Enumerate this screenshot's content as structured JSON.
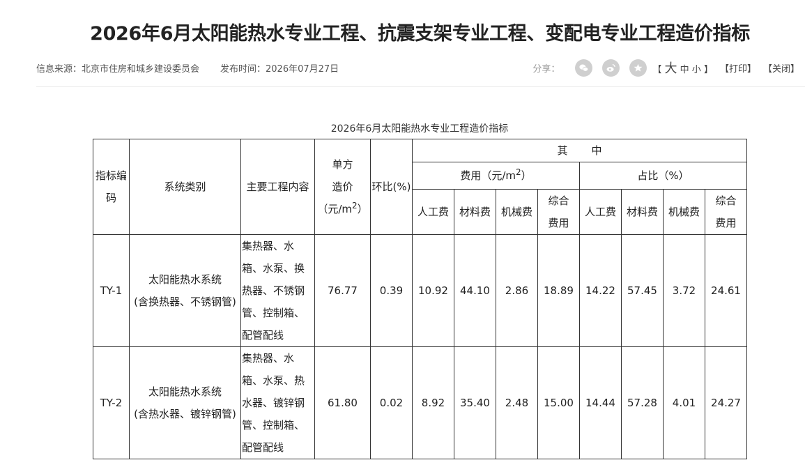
{
  "article": {
    "title": "2026年6月太阳能热水专业工程、抗震支架专业工程、变配电专业工程造价指标",
    "source": "信息来源：北京市住房和城乡建设委员会",
    "publish_time": "发布时间：2026年07月27日"
  },
  "toolbar": {
    "share_label": "分享：",
    "icons": [
      "wechat-icon",
      "weibo-icon",
      "favorite-icon"
    ],
    "font_open": "【",
    "font_large": "大",
    "font_medium": "中",
    "font_small": "小",
    "font_close": "】",
    "print_label": "【打印】",
    "close_label": "【关闭】"
  },
  "table": {
    "caption": "2026年6月太阳能热水专业工程造价指标",
    "headers": {
      "code_a": "指标编",
      "code_b": "码",
      "system_type": "系统类别",
      "main_content": "主要工程内容",
      "unit_cost_a": "单方",
      "unit_cost_b": "造价",
      "unit_cost_c": "（元/m",
      "unit_cost_sup": "2",
      "unit_cost_d": "）",
      "ratio": "环比(%)",
      "among_a": "其",
      "among_b": "中",
      "cost_group": "费用（元/m",
      "cost_group_sup": "2",
      "cost_group_close": "）",
      "share_group": "占比（%）",
      "labor": "人工费",
      "material": "材料费",
      "machine": "机械费",
      "overall_a": "综合",
      "overall_b": "费用"
    },
    "rows": [
      {
        "code": "TY-1",
        "system_a": "太阳能热水系统",
        "system_b": "(含换热器、不锈钢管)",
        "content_lines": [
          "集热器、水",
          "箱、水泵、换",
          "热器、不锈钢",
          "管、控制箱、",
          "配管配线"
        ],
        "unit_cost": "76.77",
        "ratio": "0.39",
        "labor_cost": "10.92",
        "material_cost": "44.10",
        "machine_cost": "2.86",
        "overall_cost": "18.89",
        "labor_pct": "14.22",
        "material_pct": "57.45",
        "machine_pct": "3.72",
        "overall_pct": "24.61"
      },
      {
        "code": "TY-2",
        "system_a": "太阳能热水系统",
        "system_b": "(含热水器、镀锌钢管)",
        "content_lines": [
          "集热器、水",
          "箱、水泵、热",
          "水器、镀锌钢",
          "管、控制箱、",
          "配管配线"
        ],
        "unit_cost": "61.80",
        "ratio": "0.02",
        "labor_cost": "8.92",
        "material_cost": "35.40",
        "machine_cost": "2.48",
        "overall_cost": "15.00",
        "labor_pct": "14.44",
        "material_pct": "57.28",
        "machine_pct": "4.01",
        "overall_pct": "24.27"
      }
    ]
  }
}
